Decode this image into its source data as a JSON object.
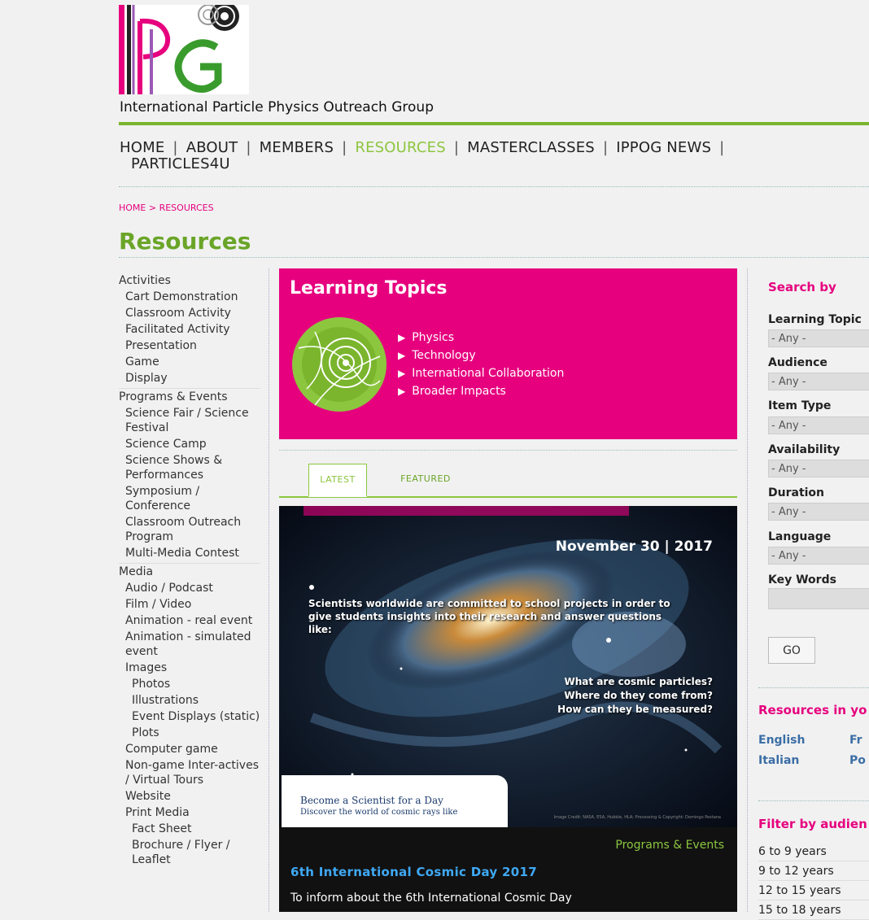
{
  "site": {
    "org_name": "International Particle Physics Outreach Group",
    "logo_alt": "IPPOG logo"
  },
  "nav": {
    "items": [
      {
        "label": "HOME"
      },
      {
        "label": "ABOUT"
      },
      {
        "label": "MEMBERS"
      },
      {
        "label": "RESOURCES",
        "active": true
      },
      {
        "label": "MASTERCLASSES"
      },
      {
        "label": "IPPOG NEWS"
      },
      {
        "label": "PARTICLES4U"
      }
    ],
    "separator": "|"
  },
  "breadcrumb": {
    "home": "HOME",
    "sep": ">",
    "current": "RESOURCES"
  },
  "page_title": "Resources",
  "sidebar": {
    "activities": {
      "label": "Activities",
      "items": [
        "Cart Demonstration",
        "Classroom Activity",
        "Facilitated Activity",
        "Presentation",
        "Game",
        "Display"
      ]
    },
    "programs": {
      "label": "Programs & Events",
      "items": [
        "Science Fair / Science Festival",
        "Science Camp",
        "Science Shows & Performances",
        "Symposium / Conference",
        "Classroom Outreach Program",
        "Multi-Media Contest"
      ]
    },
    "media": {
      "label": "Media",
      "items": [
        "Audio / Podcast",
        "Film / Video",
        "Animation - real event",
        "Animation - simulated event",
        "Images"
      ],
      "images_sub": [
        "Photos",
        "Illustrations",
        "Event Displays (static)",
        "Plots"
      ],
      "items2": [
        "Computer game",
        "Non-game Inter-actives / Virtual Tours",
        "Website",
        "Print Media"
      ],
      "print_sub": [
        "Fact Sheet",
        "Brochure / Flyer / Leaflet"
      ]
    }
  },
  "learning_topics": {
    "title": "Learning Topics",
    "items": [
      "Physics",
      "Technology",
      "International Collaboration",
      "Broader Impacts"
    ]
  },
  "tabs": {
    "latest": "LATEST",
    "featured": "FEATURED"
  },
  "feature": {
    "date": "November 30 | 2017",
    "overlay": "Scientists worldwide are committed to school projects in order to give students insights into their research and answer questions like:",
    "questions": [
      "What are cosmic particles?",
      "Where do they come from?",
      "How can they be measured?"
    ],
    "box_title": "Become a Scientist for a Day",
    "box_sub": "Discover the world of cosmic rays like",
    "credit": "Image Credit: NASA, ESA, Hubble, HLA; Processing & Copyright: Domingo Pestana",
    "category": "Programs & Events",
    "title": "6th International Cosmic Day 2017",
    "description": "To inform about the 6th International Cosmic Day"
  },
  "search": {
    "title": "Search by",
    "fields": [
      {
        "label": "Learning Topic",
        "value": "- Any -"
      },
      {
        "label": "Audience",
        "value": "- Any -"
      },
      {
        "label": "Item Type",
        "value": "- Any -"
      },
      {
        "label": "Availability",
        "value": "- Any -"
      },
      {
        "label": "Duration",
        "value": "- Any -"
      },
      {
        "label": "Language",
        "value": "- Any -"
      }
    ],
    "keywords_label": "Key Words",
    "go": "GO"
  },
  "resources_in": {
    "title": "Resources in yo",
    "links": [
      "English",
      "Fr",
      "Italian",
      "Po"
    ]
  },
  "filter_audience": {
    "title": "Filter by audien",
    "items": [
      "6 to 9 years",
      "9 to 12 years",
      "12 to 15 years",
      "15 to 18 years"
    ]
  },
  "colors": {
    "green": "#8cc63f",
    "magenta": "#e6007e",
    "link_blue": "#3b6ea5"
  }
}
